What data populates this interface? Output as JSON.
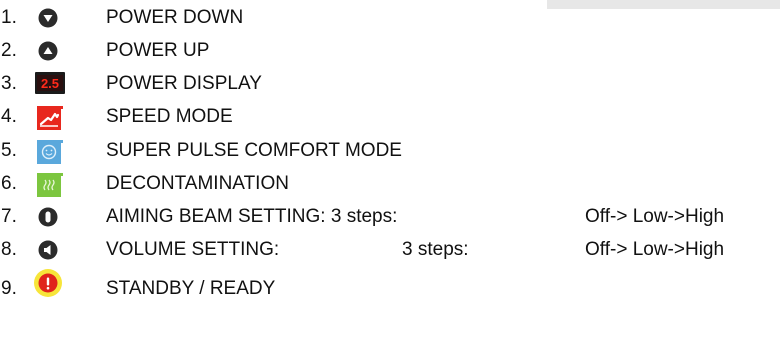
{
  "items": [
    {
      "number": "1.",
      "icon": "arrow-down-button-icon",
      "label": "POWER DOWN"
    },
    {
      "number": "2.",
      "icon": "arrow-up-button-icon",
      "label": "POWER UP"
    },
    {
      "number": "3.",
      "icon": "power-display-icon",
      "display_value": "2.5",
      "label": "POWER DISPLAY"
    },
    {
      "number": "4.",
      "icon": "speed-mode-icon",
      "label": "SPEED MODE"
    },
    {
      "number": "5.",
      "icon": "smiley-comfort-icon",
      "label": "SUPER PULSE COMFORT MODE"
    },
    {
      "number": "6.",
      "icon": "decontamination-icon",
      "label": "DECONTAMINATION"
    },
    {
      "number": "7.",
      "icon": "aiming-beam-icon",
      "label": "AIMING BEAM SETTING: 3 steps:",
      "range": "Off-> Low->High"
    },
    {
      "number": "8.",
      "icon": "volume-icon",
      "label": "VOLUME SETTING:",
      "steps": "3 steps:",
      "range": "Off-> Low->High"
    },
    {
      "number": "9.",
      "icon": "standby-ready-icon",
      "label": "STANDBY / READY"
    }
  ],
  "colors": {
    "dark_button": "#2b2b2b",
    "display_background": "#1a1a1a",
    "display_digits": "#ff2a1a",
    "speed_red": "#e8281e",
    "comfort_blue": "#5aa8dc",
    "decon_green": "#7cc63f",
    "standby_yellow": "#f7e53a",
    "standby_red": "#e0241b"
  }
}
